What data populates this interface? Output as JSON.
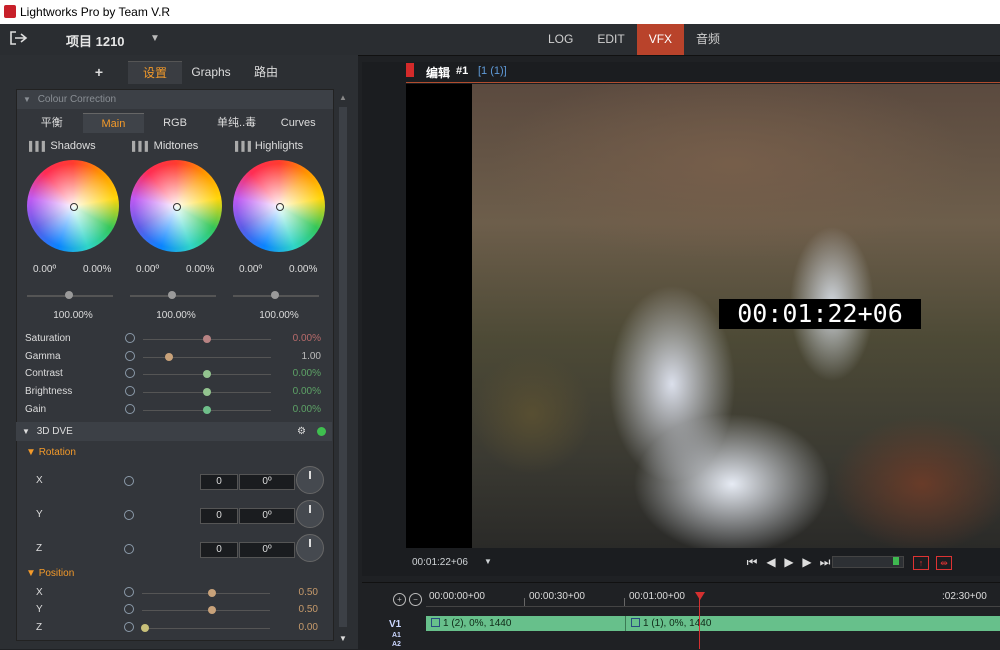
{
  "window": {
    "title": "Lightworks Pro by Team V.R"
  },
  "menubar": {
    "project": "项目 1210",
    "tabs": [
      {
        "label": "LOG",
        "active": false
      },
      {
        "label": "EDIT",
        "active": false
      },
      {
        "label": "VFX",
        "active": true
      },
      {
        "label": "音频",
        "active": false
      }
    ]
  },
  "left_panel": {
    "tabs": [
      {
        "label": "+"
      },
      {
        "label": "设置",
        "active": true
      },
      {
        "label": "Graphs"
      },
      {
        "label": "路由"
      }
    ],
    "colour_correction": {
      "header": "Colour Correction",
      "subtabs": [
        "平衡",
        "Main",
        "RGB",
        "单纯..毒",
        "Curves"
      ],
      "active_subtab": "Main",
      "wheels": [
        {
          "name": "Shadows",
          "hue": "0.00º",
          "sat": "0.00%",
          "level": "100.00%"
        },
        {
          "name": "Midtones",
          "hue": "0.00º",
          "sat": "0.00%",
          "level": "100.00%"
        },
        {
          "name": "Highlights",
          "hue": "0.00º",
          "sat": "0.00%",
          "level": "100.00%"
        }
      ],
      "properties": [
        {
          "label": "Saturation",
          "value": "0.00%",
          "knob_color": "#b88383",
          "value_color": "#b86b6b",
          "level": 0.5
        },
        {
          "label": "Gamma",
          "value": "1.00",
          "knob_color": "#c8a27a",
          "value_color": "#bdbdbd",
          "level": 0.2
        },
        {
          "label": "Contrast",
          "value": "0.00%",
          "knob_color": "#93c48f",
          "value_color": "#5da266",
          "level": 0.5
        },
        {
          "label": "Brightness",
          "value": "0.00%",
          "knob_color": "#93c48f",
          "value_color": "#5da266",
          "level": 0.5
        },
        {
          "label": "Gain",
          "value": "0.00%",
          "knob_color": "#6fbf8a",
          "value_color": "#5da266",
          "level": 0.5
        }
      ]
    },
    "dve": {
      "header": "3D DVE",
      "rotation_label": "Rotation",
      "rotation": [
        {
          "axis": "X",
          "turns": "0",
          "degrees": "0º"
        },
        {
          "axis": "Y",
          "turns": "0",
          "degrees": "0º"
        },
        {
          "axis": "Z",
          "turns": "0",
          "degrees": "0º"
        }
      ],
      "position_label": "Position",
      "position": [
        {
          "axis": "X",
          "value": "0.50",
          "level": 0.55
        },
        {
          "axis": "Y",
          "value": "0.50",
          "level": 0.55
        },
        {
          "axis": "Z",
          "value": "0.00",
          "level": 0.02
        }
      ]
    }
  },
  "viewer": {
    "title": "编辑",
    "number": "#1",
    "clip_ref": "[1 (1)]",
    "overlay_timecode": "00:01:22+06",
    "current_timecode": "00:01:22+06"
  },
  "timeline": {
    "ruler_labels": [
      "00:00:00+00",
      "00:00:30+00",
      "00:01:00+00",
      ":02:30+00"
    ],
    "tracks": [
      "V1",
      "A1",
      "A2"
    ],
    "clips": [
      {
        "label": "1 (2), 0%, 1440"
      },
      {
        "label": "1 (1), 0%, 1440"
      }
    ]
  },
  "colors": {
    "accent": "#f39a2a",
    "active_tab": "#b9432b",
    "clip": "#67c08b",
    "playhead": "#d43030"
  }
}
